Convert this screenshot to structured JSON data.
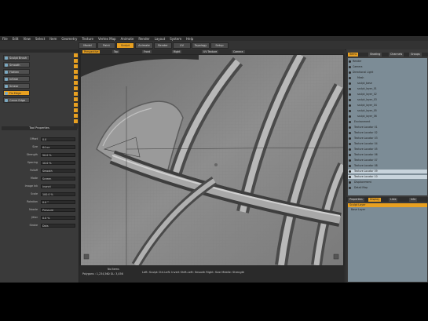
{
  "menubar": {
    "items": [
      "File",
      "Edit",
      "View",
      "Select",
      "Item",
      "Geometry",
      "Texture",
      "Vertex Map",
      "Animate",
      "Render",
      "Layout",
      "System",
      "Help"
    ]
  },
  "toolbar": {
    "buttons": [
      "Model",
      "Paint",
      "Sculpt",
      "Animate",
      "Render",
      "UV",
      "Topology",
      "Setup"
    ],
    "active_index": 2
  },
  "left_panel": {
    "tools": [
      "Sculpt Brush",
      "Smooth",
      "Flatten",
      "Inflate",
      "Smear",
      "Fix Edge",
      "Carve Edge"
    ],
    "active_tool_index": 5,
    "properties_header": "Tool Properties",
    "properties": [
      {
        "label": "Offset",
        "value": "0.0"
      },
      {
        "label": "Size",
        "value": "64 px"
      },
      {
        "label": "Strength",
        "value": "50.0 %"
      },
      {
        "label": "Spacing",
        "value": "10.0 %"
      },
      {
        "label": "Falloff",
        "value": "Smooth"
      },
      {
        "label": "Mode",
        "value": "Screen"
      },
      {
        "label": "Image Ink",
        "value": "(none)"
      },
      {
        "label": "Scale",
        "value": "100.0 %"
      },
      {
        "label": "Rotation",
        "value": "0.0 °"
      },
      {
        "label": "Nozzle",
        "value": "Pressure"
      },
      {
        "label": "Jitter",
        "value": "0.0 %"
      },
      {
        "label": "Stroke",
        "value": "Dots"
      }
    ]
  },
  "viewport": {
    "tabs": [
      "Perspective",
      "Top",
      "Front",
      "Right",
      "UV Texture",
      "Camera"
    ],
    "active_tab_index": 0,
    "status_hint": "Left: Sculpt  Ctrl-Left: Invert  Shift-Left: Smooth  Right: Size  Middle: Strength",
    "status_line1": "No Items",
    "status_line2": "Polygons : 1,234,560   GL: 3,456"
  },
  "right_panel": {
    "tabs": [
      "Items",
      "Shading",
      "Channels",
      "Groups"
    ],
    "active_tab_index": 0,
    "tree_rows": [
      "Render",
      "Camera",
      "Directional Light",
      "Mesh",
      "sculpt_base",
      "sculpt_layer_01",
      "sculpt_layer_02",
      "sculpt_layer_03",
      "sculpt_layer_04",
      "sculpt_layer_05",
      "sculpt_layer_06",
      "Environment",
      "Texture Locator 01",
      "Texture Locator 02",
      "Texture Locator 03",
      "Texture Locator 04",
      "Texture Locator 05",
      "Texture Locator 06",
      "Texture Locator 07",
      "Texture Locator 08",
      "Texture Locator 09",
      "Texture Locator 10",
      "Displacement",
      "Detail Map"
    ],
    "selected_rows": [
      20,
      21
    ],
    "sub_tabs": [
      "Properties",
      "Display",
      "Lists",
      "Info"
    ],
    "list_header": "Sculpt Layer",
    "list_rows": [
      "Base Layer"
    ]
  },
  "colors": {
    "accent": "#e8a020",
    "panel": "#3a3a3a",
    "tree_bg": "#7c8c96"
  }
}
